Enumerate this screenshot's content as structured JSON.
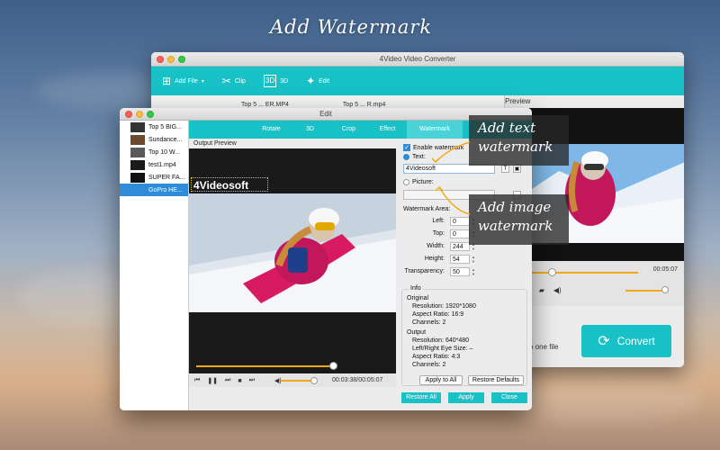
{
  "headline": "Add Watermark",
  "back_window": {
    "title": "4Video Video Converter",
    "toolbar": [
      {
        "label": "Add File",
        "icon": "add-file-icon"
      },
      {
        "label": "Clip",
        "icon": "scissors-icon"
      },
      {
        "label": "3D",
        "icon": "3d-icon"
      },
      {
        "label": "Edit",
        "icon": "edit-icon"
      }
    ],
    "list_row": {
      "source": "Top 5 ... ER.MP4",
      "target": "Top 5 ... R.mp4"
    },
    "preview_label": "Preview",
    "time": "00:05:07",
    "merge_text": "o one file",
    "convert_label": "Convert"
  },
  "edit_window": {
    "title": "Edit",
    "files": [
      "Top 5 BIG...",
      "Sundance...",
      "Top 10 W...",
      "test1.mp4",
      "SUPER FA...",
      "GoPro HE..."
    ],
    "selected_file_index": 5,
    "tabs": [
      "Rotate",
      "3D",
      "Crop",
      "Effect",
      "Watermark"
    ],
    "active_tab": "Watermark",
    "output_preview_label": "Output Preview",
    "watermark_overlay": "4Videosoft",
    "time": "00:03:38/00:05:07",
    "playback_progress_pct": 92,
    "panel": {
      "enable_label": "Enable watermark",
      "text_label": "Text:",
      "text_value": "4Videosoft",
      "picture_label": "Picture:",
      "area_label": "Watermark Area:",
      "left_label": "Left:",
      "left_value": "0",
      "top_label": "Top:",
      "top_value": "0",
      "width_label": "Width:",
      "width_value": "244",
      "height_label": "Height:",
      "height_value": "54",
      "transparency_label": "Transparency:",
      "transparency_value": "50"
    },
    "info": {
      "heading": "Info",
      "original_heading": "Original",
      "original_resolution": "Resolution: 1920*1080",
      "original_aspect": "Aspect Ratio: 16:9",
      "original_channels": "Channels: 2",
      "output_heading": "Output",
      "output_resolution": "Resolution: 640*480",
      "output_eye": "Left/Right Eye Size: –",
      "output_aspect": "Aspect Ratio: 4:3",
      "output_channels": "Channels: 2"
    },
    "apply_all_label": "Apply to All",
    "restore_defaults_label": "Restore Defaults",
    "restore_all_label": "Restore All",
    "apply_label": "Apply",
    "close_label": "Close"
  },
  "callouts": {
    "text_line1": "Add text",
    "text_line2": "watermark",
    "image_line1": "Add image",
    "image_line2": "watermark"
  },
  "colors": {
    "accent": "#17c1c6",
    "selection": "#2f8cd8",
    "progress": "#f3a917"
  }
}
